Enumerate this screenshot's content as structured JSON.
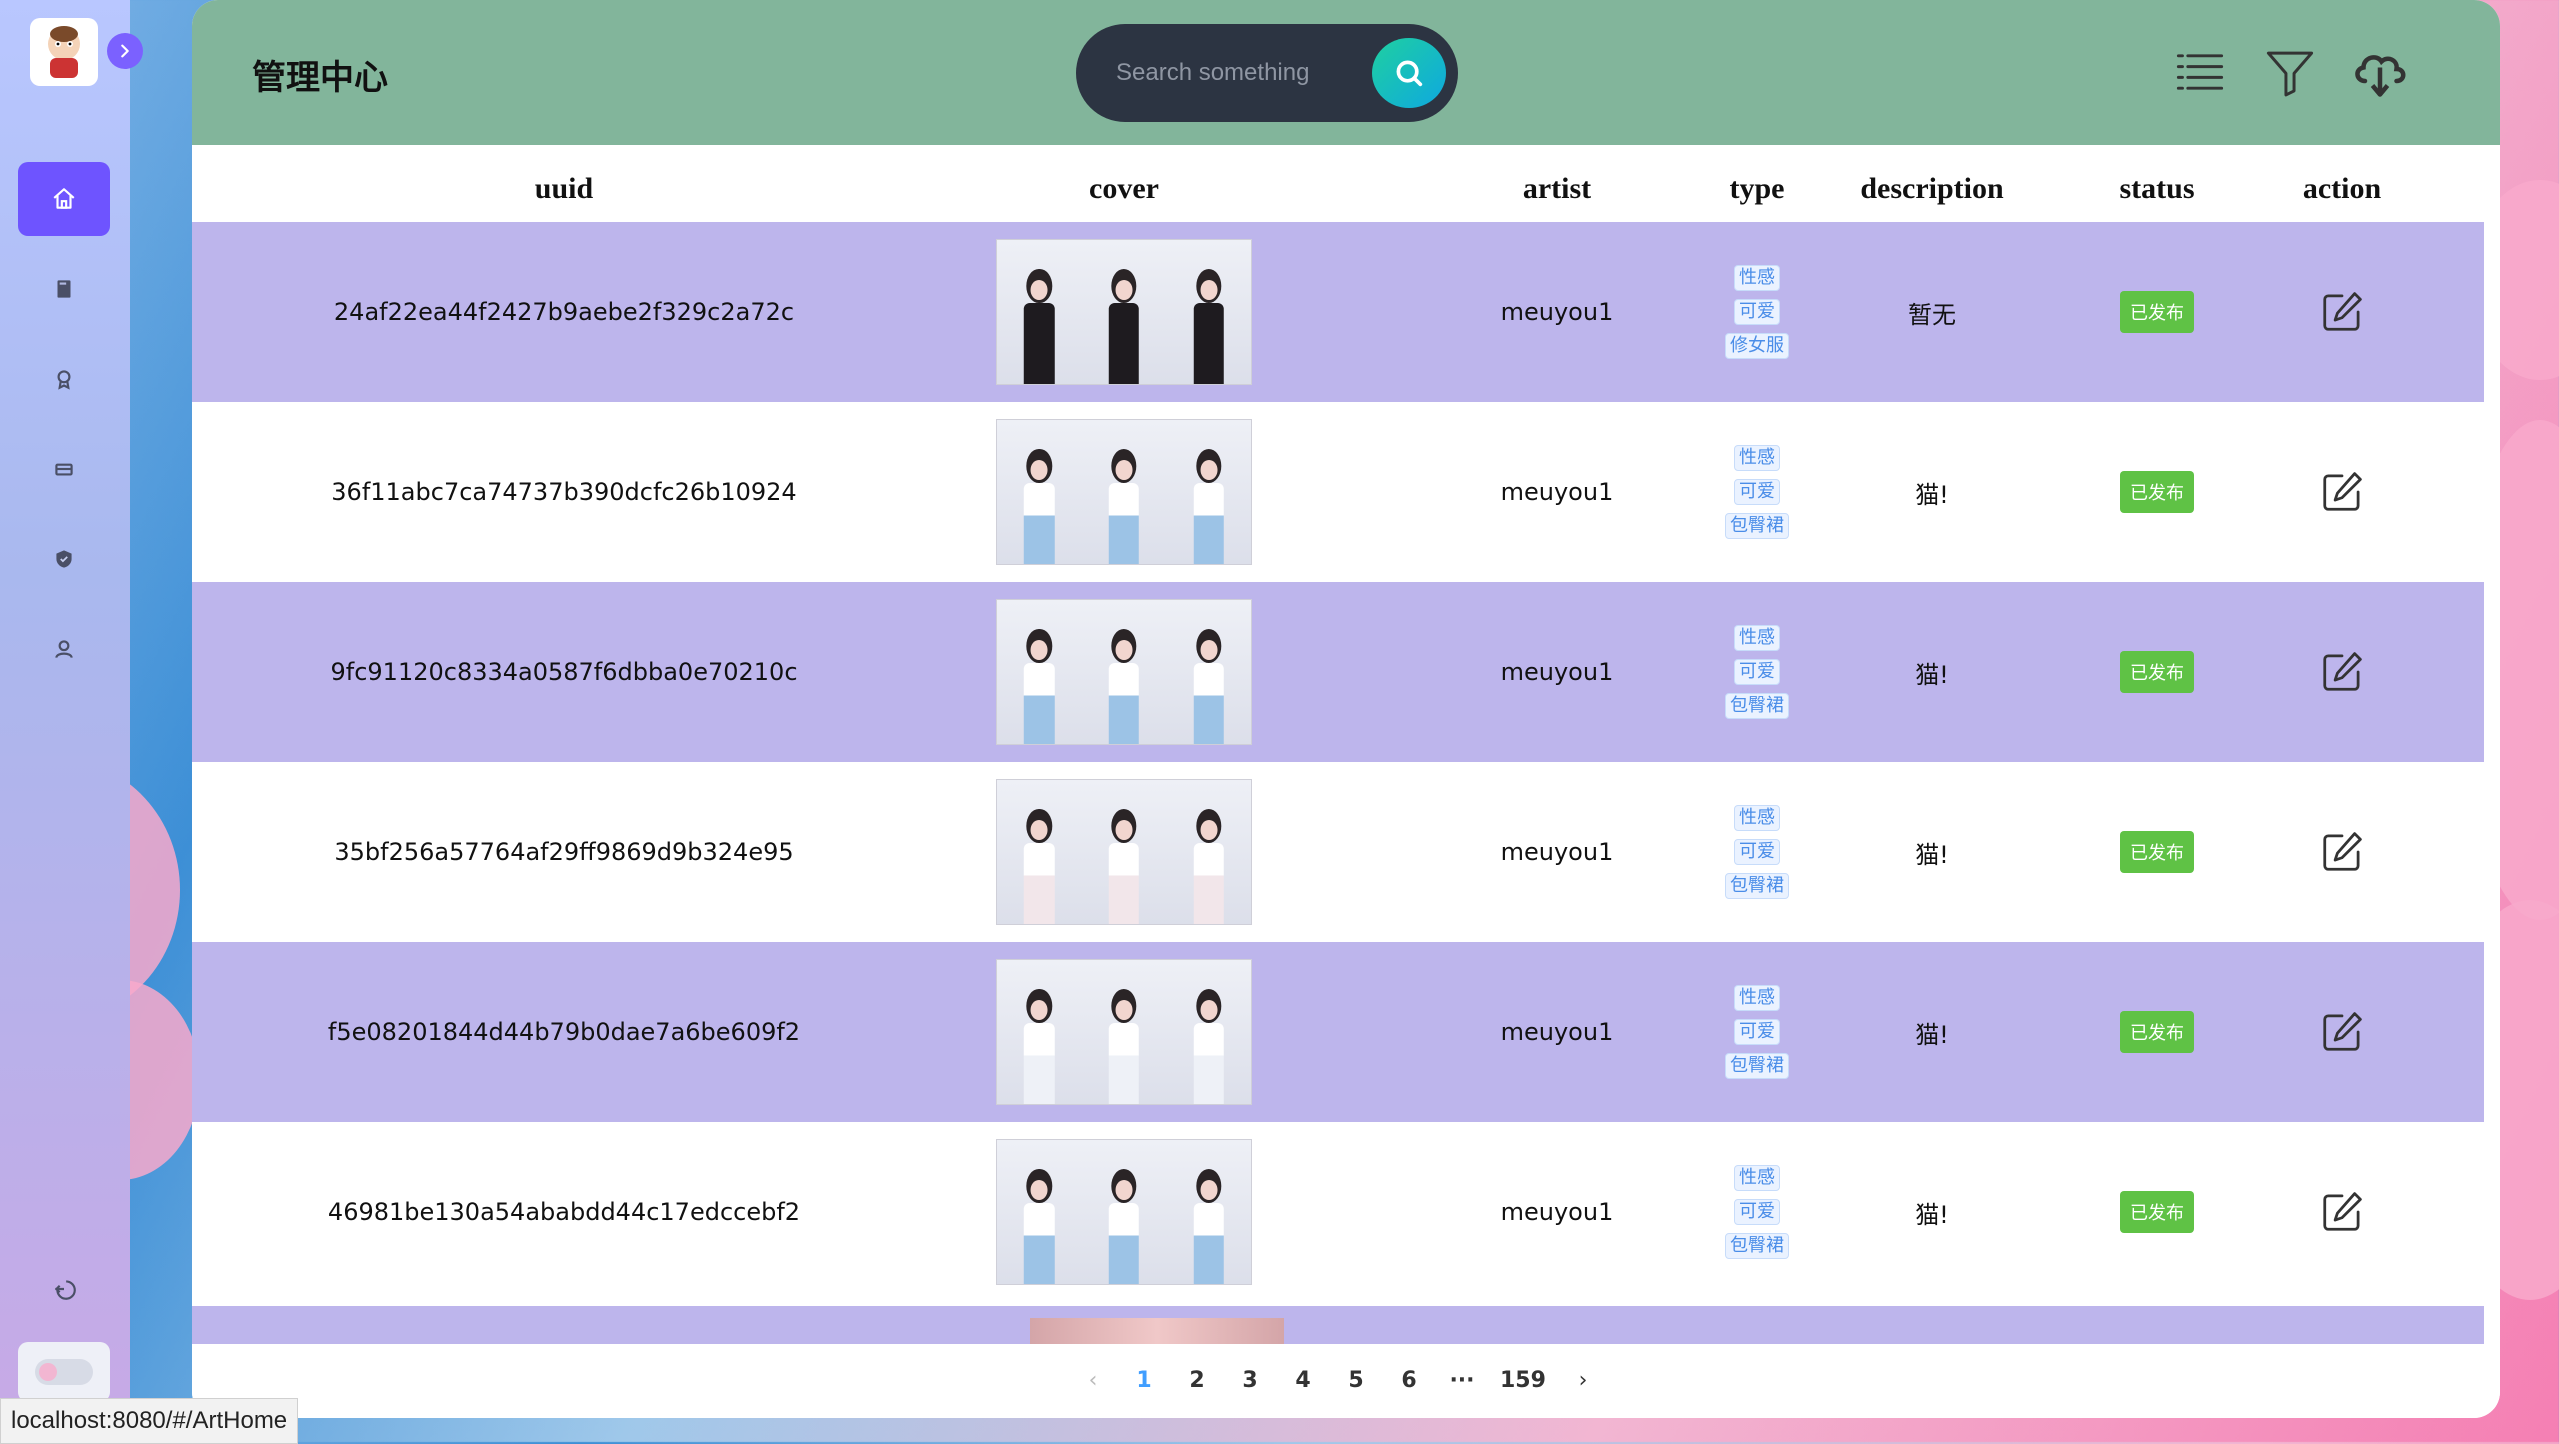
{
  "header": {
    "title": "管理中心",
    "search_placeholder": "Search something"
  },
  "sidebar": {
    "items": [
      "home-icon",
      "book-icon",
      "award-icon",
      "card-icon",
      "shield-icon",
      "user-icon"
    ],
    "logout_icon": "logout-icon"
  },
  "table": {
    "columns": [
      "uuid",
      "cover",
      "artist",
      "type",
      "description",
      "status",
      "action"
    ],
    "rows": [
      {
        "uuid": "24af22ea44f2427b9aebe2f329c2a72c",
        "artist": "meuyou1",
        "tags": [
          "性感",
          "可爱",
          "修女服"
        ],
        "description": "暂无",
        "status": "已发布"
      },
      {
        "uuid": "36f11abc7ca74737b390dcfc26b10924",
        "artist": "meuyou1",
        "tags": [
          "性感",
          "可爱",
          "包臀裙"
        ],
        "description": "猫!",
        "status": "已发布"
      },
      {
        "uuid": "9fc91120c8334a0587f6dbba0e70210c",
        "artist": "meuyou1",
        "tags": [
          "性感",
          "可爱",
          "包臀裙"
        ],
        "description": "猫!",
        "status": "已发布"
      },
      {
        "uuid": "35bf256a57764af29ff9869d9b324e95",
        "artist": "meuyou1",
        "tags": [
          "性感",
          "可爱",
          "包臀裙"
        ],
        "description": "猫!",
        "status": "已发布"
      },
      {
        "uuid": "f5e08201844d44b79b0dae7a6be609f2",
        "artist": "meuyou1",
        "tags": [
          "性感",
          "可爱",
          "包臀裙"
        ],
        "description": "猫!",
        "status": "已发布"
      },
      {
        "uuid": "46981be130a54ababdd44c17edccebf2",
        "artist": "meuyou1",
        "tags": [
          "性感",
          "可爱",
          "包臀裙"
        ],
        "description": "猫!",
        "status": "已发布"
      }
    ]
  },
  "pagination": {
    "pages": [
      "1",
      "2",
      "3",
      "4",
      "5",
      "6",
      "···",
      "159"
    ],
    "current": "1"
  },
  "status_bar": {
    "url": "localhost:8080/#/ArtHome"
  },
  "colors": {
    "header_bg": "#82b59b",
    "row_highlight": "#bdb5ec",
    "active_nav": "#6e54ff",
    "status_green": "#5fc245",
    "tag_blue": "#4a8de8"
  }
}
